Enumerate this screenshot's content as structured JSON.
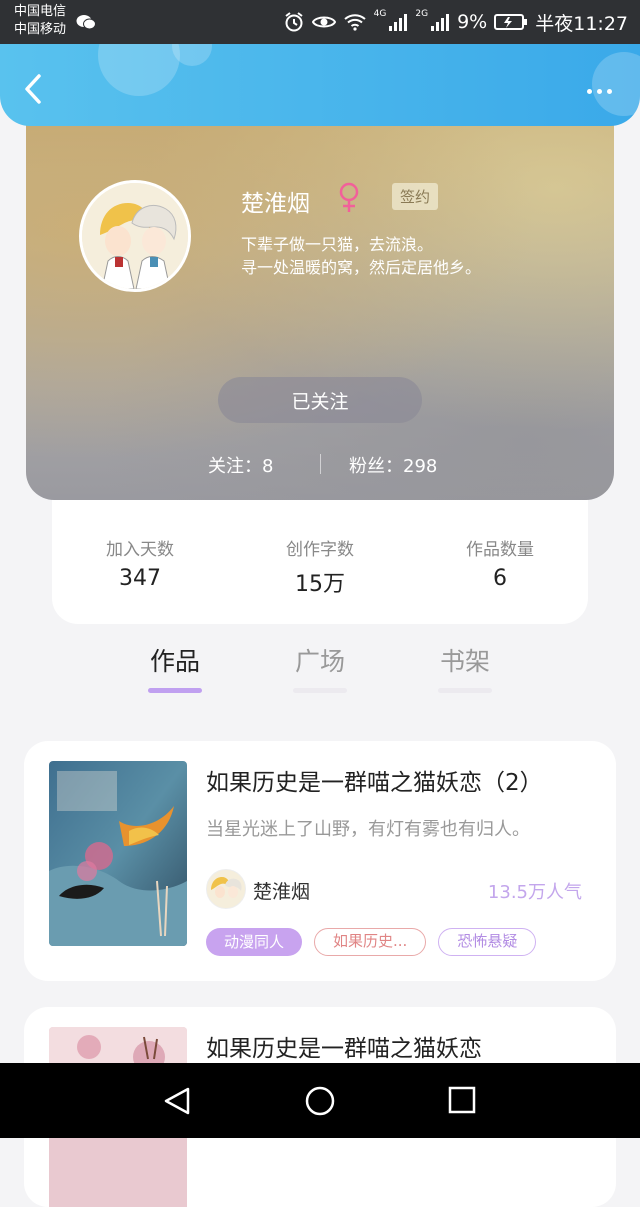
{
  "status_bar": {
    "carrier_1": "中国电信",
    "carrier_2": "中国移动",
    "network_1": "4G",
    "network_2": "2G",
    "battery": "9%",
    "time": "半夜11:27"
  },
  "profile": {
    "name": "楚淮烟",
    "badge": "签约",
    "bio_line_1": "下辈子做一只猫，去流浪。",
    "bio_line_2": "寻一处温暖的窝，然后定居他乡。",
    "follow_button": "已关注",
    "following": "关注：8",
    "fans": "粉丝：298"
  },
  "stats": [
    {
      "label": "加入天数",
      "value": "347"
    },
    {
      "label": "创作字数",
      "value": "15万"
    },
    {
      "label": "作品数量",
      "value": "6"
    }
  ],
  "tabs": [
    {
      "label": "作品",
      "active": true
    },
    {
      "label": "广场",
      "active": false
    },
    {
      "label": "书架",
      "active": false
    }
  ],
  "works": [
    {
      "title": "如果历史是一群喵之猫妖恋（2）",
      "description": "当星光迷上了山野，有灯有雾也有归人。",
      "author": "楚淮烟",
      "popularity": "13.5万人气",
      "tags": [
        "动漫同人",
        "如果历史...",
        "恐怖悬疑"
      ]
    },
    {
      "title": "如果历史是一群喵之猫妖恋"
    }
  ],
  "colors": {
    "header": "#3aa9e9",
    "accent_purple": "#c8a3ef",
    "tag_red": "#e08585"
  }
}
